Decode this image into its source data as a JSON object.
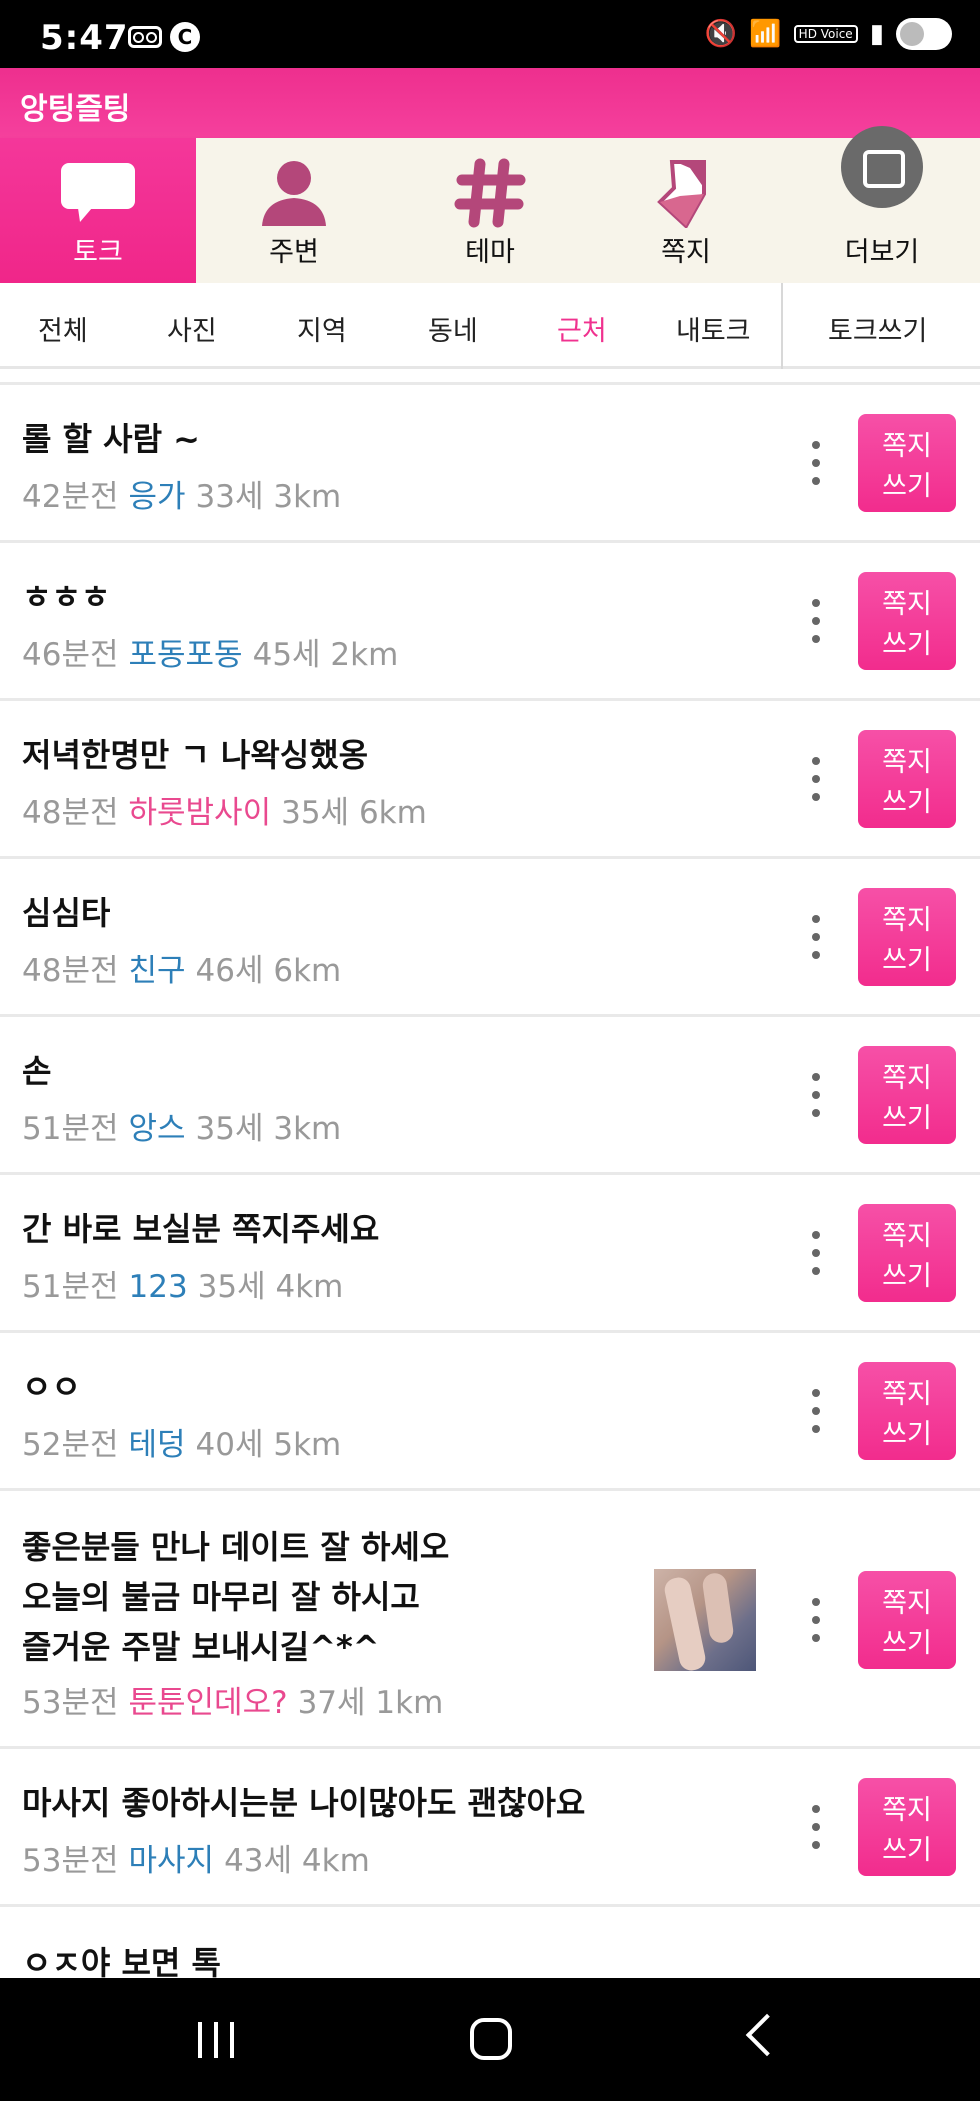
{
  "status_bar": {
    "time": "5:47",
    "c_badge": "C",
    "hd_label": "HD Voice",
    "wifi_badge": "5"
  },
  "app": {
    "title": "앙팅즐팅"
  },
  "top_tabs": [
    {
      "label": "토크",
      "icon": "chat-bubble-icon",
      "active": true
    },
    {
      "label": "주변",
      "icon": "person-icon",
      "active": false
    },
    {
      "label": "테마",
      "icon": "hashtag-icon",
      "active": false
    },
    {
      "label": "쪽지",
      "icon": "message-envelope-icon",
      "active": false
    },
    {
      "label": "더보기",
      "icon": "more-icon",
      "active": false
    }
  ],
  "sub_tabs": [
    {
      "label": "전체",
      "active": false
    },
    {
      "label": "사진",
      "active": false
    },
    {
      "label": "지역",
      "active": false
    },
    {
      "label": "동네",
      "active": false
    },
    {
      "label": "근처",
      "active": true
    },
    {
      "label": "내토크",
      "active": false
    },
    {
      "label": "토크쓰기",
      "active": false
    }
  ],
  "colors": {
    "accent": "#f02689",
    "nick_blue": "#2d7fb8",
    "nick_pink": "#e9498f"
  },
  "message_button_label": {
    "line1": "쪽지",
    "line2": "쓰기"
  },
  "posts": [
    {
      "title": "롤 할 사람 ~",
      "time": "42분전",
      "nickname": "응가",
      "nick_color": "blue",
      "age": "33세",
      "distance": "3km"
    },
    {
      "title": "ㅎㅎㅎ",
      "time": "46분전",
      "nickname": "포동포동",
      "nick_color": "blue",
      "age": "45세",
      "distance": "2km"
    },
    {
      "title": "저녁한명만 ㄱ 나왁싱했옹",
      "time": "48분전",
      "nickname": "하룻밤사이",
      "nick_color": "pink",
      "age": "35세",
      "distance": "6km"
    },
    {
      "title": "심심타",
      "time": "48분전",
      "nickname": "친구",
      "nick_color": "blue",
      "age": "46세",
      "distance": "6km"
    },
    {
      "title": "손",
      "time": "51분전",
      "nickname": "앙스",
      "nick_color": "blue",
      "age": "35세",
      "distance": "3km"
    },
    {
      "title": "간 바로 보실분 쪽지주세요",
      "time": "51분전",
      "nickname": "123",
      "nick_color": "blue",
      "age": "35세",
      "distance": "4km"
    },
    {
      "title": "ㅇㅇ",
      "time": "52분전",
      "nickname": "테덩",
      "nick_color": "blue",
      "age": "40세",
      "distance": "5km"
    },
    {
      "title_lines": [
        "좋은분들 만나 데이트 잘 하세오",
        "오늘의 불금 마무리 잘 하시고",
        "즐거운 주말 보내시길^*^"
      ],
      "time": "53분전",
      "nickname": "툰툰인데오?",
      "nick_color": "pink",
      "age": "37세",
      "distance": "1km",
      "has_photo": true
    },
    {
      "title": "마사지 좋아하시는분 나이많아도 괜찮아요",
      "time": "53분전",
      "nickname": "마사지",
      "nick_color": "blue",
      "age": "43세",
      "distance": "4km"
    },
    {
      "title": "ㅇㅈ야 보면 톡"
    }
  ]
}
